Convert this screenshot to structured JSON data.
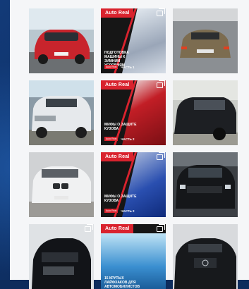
{
  "brand": "Auto Real",
  "grid": {
    "tiles": [
      {
        "id": "red-porsche",
        "kind": "photo",
        "bg": "#c8242c",
        "plate": "С444УК777"
      },
      {
        "id": "promo-winter",
        "kind": "promo",
        "title": "ПОДГОТОВКА МАШИНЫ К ЗИМНИМ УСЛОВИЯМ",
        "tag": "Auto Real",
        "part": "ЧАСТЬ 1",
        "accent": "#9aa6b8"
      },
      {
        "id": "gold-mercedes",
        "kind": "photo",
        "bg": "#7c6c50"
      },
      {
        "id": "white-land-cruiser",
        "kind": "photo",
        "bg": "#d8dcdf"
      },
      {
        "id": "promo-body-protection-1",
        "kind": "promo",
        "title": "МИФЫ О ЗАЩИТЕ КУЗОВА",
        "tag": "Auto Real",
        "part": "ЧАСТЬ 2",
        "accent": "#c21e26"
      },
      {
        "id": "black-suv",
        "kind": "photo",
        "bg": "#2a2c30"
      },
      {
        "id": "white-bmw-x5",
        "kind": "photo",
        "bg": "#e8e8ea"
      },
      {
        "id": "promo-body-protection-2",
        "kind": "promo",
        "title": "МИФЫ О ЗАЩИТЕ КУЗОВА",
        "tag": "Auto Real",
        "part": "ЧАСТЬ 2",
        "accent": "#2a4fb0"
      },
      {
        "id": "black-land-cruiser",
        "kind": "photo",
        "bg": "#202226"
      },
      {
        "id": "black-sedan-showroom",
        "kind": "photo",
        "bg": "#121418"
      },
      {
        "id": "promo-lifehacks",
        "kind": "promo",
        "title": "15 КРУТЫХ ЛАЙФХАКОВ ДЛЯ АВТОМОБИЛИСТОВ",
        "tag": "",
        "part": "",
        "accent": "#3a8fd0"
      },
      {
        "id": "black-mercedes-e",
        "kind": "photo",
        "bg": "#1a1c20"
      }
    ]
  }
}
